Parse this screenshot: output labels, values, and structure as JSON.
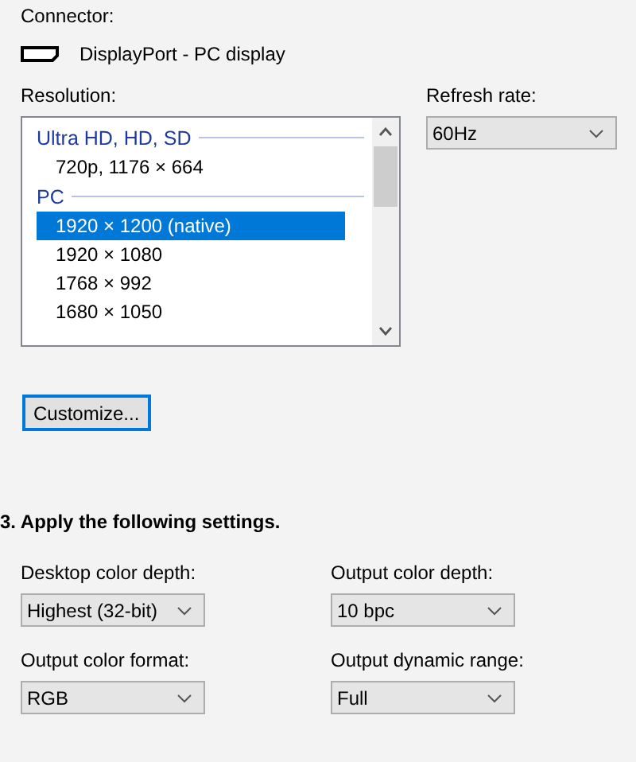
{
  "connector": {
    "label": "Connector:",
    "value": "DisplayPort - PC display"
  },
  "resolution": {
    "label": "Resolution:",
    "entries": [
      {
        "kind": "group",
        "text": "Ultra HD, HD, SD"
      },
      {
        "kind": "item",
        "text": "720p, 1176 × 664",
        "selected": false
      },
      {
        "kind": "group",
        "text": "PC"
      },
      {
        "kind": "item",
        "text": "1920 × 1200 (native)",
        "selected": true
      },
      {
        "kind": "item",
        "text": "1920 × 1080",
        "selected": false
      },
      {
        "kind": "item",
        "text": "1768 × 992",
        "selected": false
      },
      {
        "kind": "item",
        "text": "1680 × 1050",
        "selected": false
      }
    ]
  },
  "refresh_rate": {
    "label": "Refresh rate:",
    "value": "60Hz"
  },
  "customize_button": "Customize...",
  "apply_heading": "3. Apply the following settings.",
  "settings": [
    {
      "label": "Desktop color depth:",
      "value": "Highest (32-bit)"
    },
    {
      "label": "Output color depth:",
      "value": "10 bpc"
    },
    {
      "label": "Output color format:",
      "value": "RGB"
    },
    {
      "label": "Output dynamic range:",
      "value": "Full"
    }
  ]
}
